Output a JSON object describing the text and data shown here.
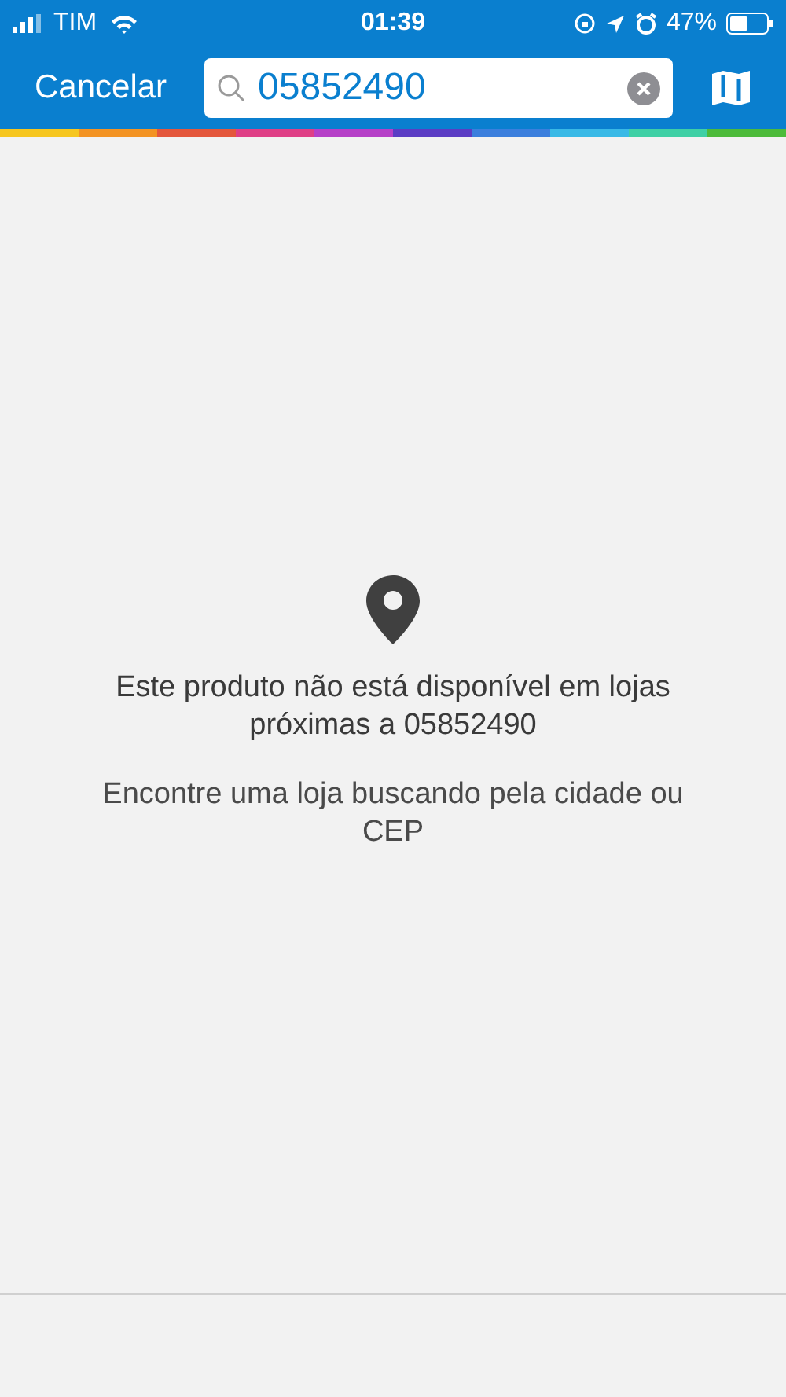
{
  "status_bar": {
    "carrier": "TIM",
    "time": "01:39",
    "battery": "47%"
  },
  "nav_bar": {
    "cancel": "Cancelar",
    "search": {
      "value": "05852490"
    }
  },
  "empty_state": {
    "title": "Este produto não está disponível em lojas próximas a 05852490",
    "hint": "Encontre uma loja buscando pela cidade ou CEP"
  }
}
